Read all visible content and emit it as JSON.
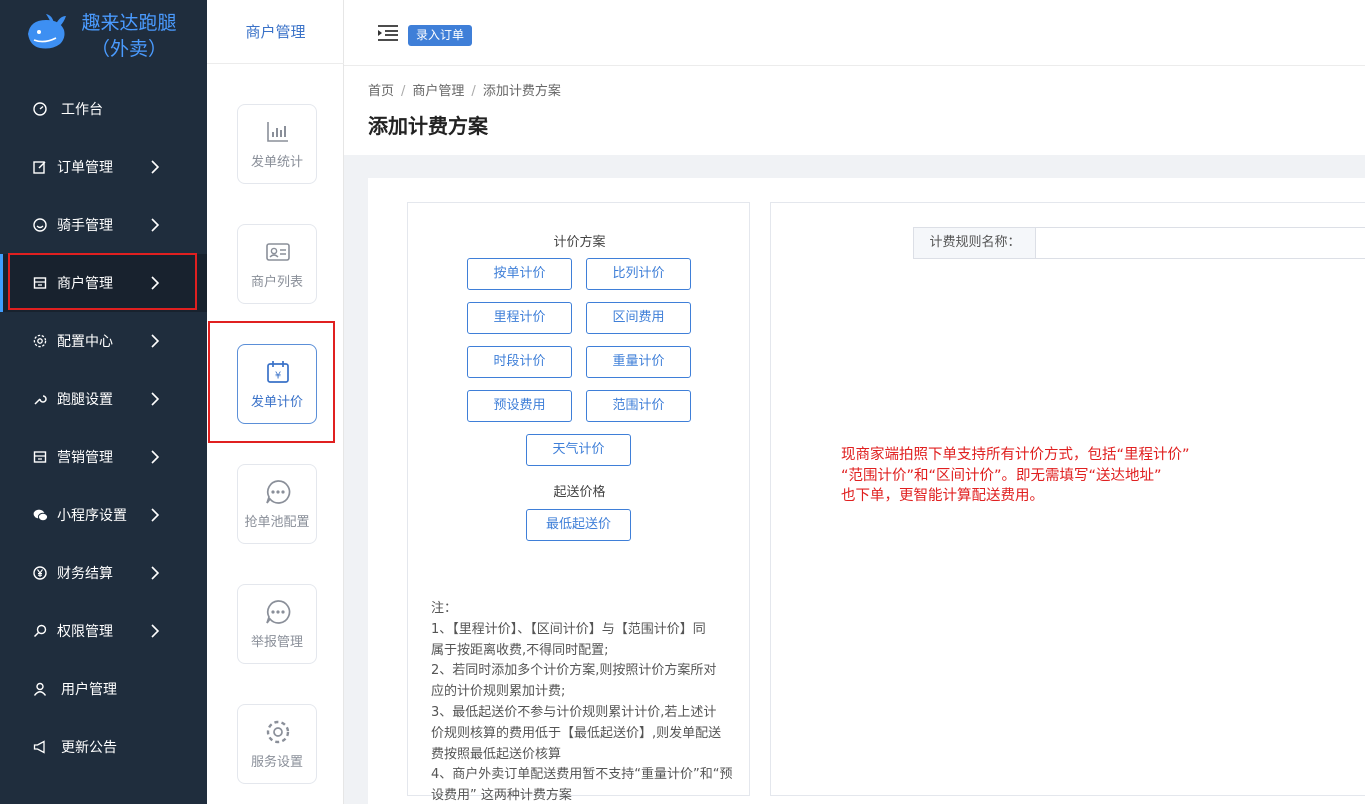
{
  "app": {
    "title_line1": "趣来达跑腿",
    "title_line2": "（外卖）"
  },
  "sidebar": {
    "items": [
      {
        "label": "工作台",
        "icon": "dashboard-icon",
        "has_arrow": false
      },
      {
        "label": "订单管理",
        "icon": "edit-icon",
        "has_arrow": true
      },
      {
        "label": "骑手管理",
        "icon": "smile-icon",
        "has_arrow": true
      },
      {
        "label": "商户管理",
        "icon": "store-icon",
        "has_arrow": true
      },
      {
        "label": "配置中心",
        "icon": "gear-icon",
        "has_arrow": true
      },
      {
        "label": "跑腿设置",
        "icon": "wrench-icon",
        "has_arrow": true
      },
      {
        "label": "营销管理",
        "icon": "shop-icon",
        "has_arrow": true
      },
      {
        "label": "小程序设置",
        "icon": "wechat-icon",
        "has_arrow": true
      },
      {
        "label": "财务结算",
        "icon": "yen-icon",
        "has_arrow": true
      },
      {
        "label": "权限管理",
        "icon": "key-icon",
        "has_arrow": true
      },
      {
        "label": "用户管理",
        "icon": "user-icon",
        "has_arrow": false
      },
      {
        "label": "更新公告",
        "icon": "megaphone-icon",
        "has_arrow": false
      }
    ],
    "active_item": "商户管理"
  },
  "subpanel": {
    "title": "商户管理",
    "items": [
      {
        "label": "发单统计",
        "icon": "bar-chart-icon"
      },
      {
        "label": "商户列表",
        "icon": "id-card-icon"
      },
      {
        "label": "发单计价",
        "icon": "calendar-yen-icon"
      },
      {
        "label": "抢单池配置",
        "icon": "chat-bubble-icon"
      },
      {
        "label": "举报管理",
        "icon": "chat-bubble-icon"
      },
      {
        "label": "服务设置",
        "icon": "gear-icon"
      }
    ],
    "active_item": "发单计价"
  },
  "topbar": {
    "record_order_label": "录入订单"
  },
  "breadcrumb": [
    "首页",
    "商户管理",
    "添加计费方案"
  ],
  "page_title": "添加计费方案",
  "scheme": {
    "section_title": "计价方案",
    "buttons": [
      "按单计价",
      "比列计价",
      "里程计价",
      "区间费用",
      "时段计价",
      "重量计价",
      "预设费用",
      "范围计价",
      "天气计价"
    ],
    "min_price_title": "起送价格",
    "min_price_button": "最低起送价",
    "notes": [
      "注：",
      "1、【里程计价】、【区间计价】与【范围计价】同",
      "属于按距离收费,不得同时配置;",
      "2、若同时添加多个计价方案,则按照计价方案所对",
      "应的计价规则累加计费;",
      "3、最低起送价不参与计价规则累计计价,若上述计",
      "价规则核算的费用低于【最低起送价】,则发单配送",
      "费按照最低起送价核算",
      "4、商户外卖订单配送费用暂不支持“重量计价”和“预",
      "设费用” 这两种计费方案"
    ]
  },
  "form": {
    "rule_name_label": "计费规则名称：",
    "rule_name_value": ""
  },
  "annotation": {
    "lines": [
      "现商家端拍照下单支持所有计价方式，包括“里程计价”",
      " “范围计价”和“区间计价”。即无需填写“送达地址”",
      "也下单，更智能计算配送费用。"
    ]
  },
  "colors": {
    "sidebar_bg": "#1f2d3d",
    "accent": "#3f7fd8",
    "highlight_red": "#e02020"
  }
}
